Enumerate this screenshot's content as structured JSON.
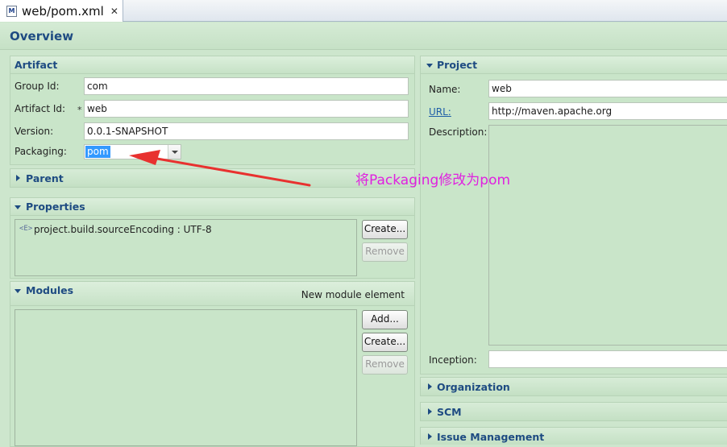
{
  "editor_tab": {
    "icon_text": "M",
    "label": "web/pom.xml",
    "close": "✕"
  },
  "form": {
    "title": "Overview"
  },
  "artifact": {
    "title": "Artifact",
    "group_id_label": "Group Id:",
    "group_id_value": "com",
    "artifact_id_label": "Artifact Id:",
    "artifact_id_required": "*",
    "artifact_id_value": "web",
    "version_label": "Version:",
    "version_value": "0.0.1-SNAPSHOT",
    "packaging_label": "Packaging:",
    "packaging_value": "pom"
  },
  "parent": {
    "title": "Parent"
  },
  "properties": {
    "title": "Properties",
    "items": [
      {
        "icon": "<E>",
        "text": "project.build.sourceEncoding : UTF-8"
      }
    ],
    "create_button": "Create...",
    "remove_button": "Remove"
  },
  "modules": {
    "title": "Modules",
    "new_element_label": "New module element",
    "add_button": "Add...",
    "create_button": "Create...",
    "remove_button": "Remove"
  },
  "project": {
    "title": "Project",
    "name_label": "Name:",
    "name_value": "web",
    "url_label": "URL:",
    "url_value": "http://maven.apache.org",
    "description_label": "Description:",
    "inception_label": "Inception:",
    "inception_value": ""
  },
  "organization": {
    "title": "Organization"
  },
  "scm": {
    "title": "SCM"
  },
  "issue_management": {
    "title": "Issue Management"
  },
  "annotation": {
    "text": "将Packaging修改为pom",
    "color": "#e020e0"
  },
  "colors": {
    "background": "#cde6cd",
    "section_title": "#1e4b82",
    "arrow": "#e8312f"
  }
}
